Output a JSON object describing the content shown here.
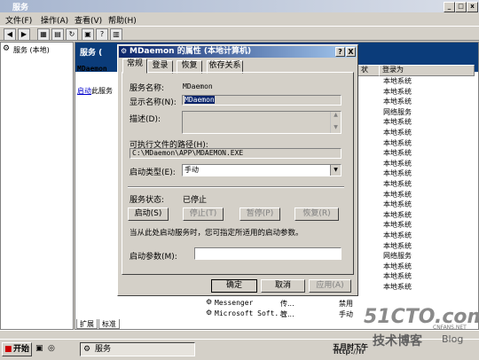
{
  "window": {
    "title": "服务"
  },
  "menu": [
    "文件(F)",
    "操作(A)",
    "查看(V)",
    "帮助(H)"
  ],
  "tree": {
    "root": "服务 (本地)"
  },
  "content": {
    "header": "服务 (",
    "left_name": "MDaemon",
    "start_link": "启动",
    "start_link_rest": "此服务",
    "col_status": "状",
    "col_logon": "登录为",
    "logon_rows": [
      "本地系统",
      "本地系统",
      "本地系统",
      "网络服务",
      "本地系统",
      "本地系统",
      "本地系统",
      "本地系统",
      "本地系统",
      "本地系统",
      "本地系统",
      "本地系统",
      "本地系统",
      "本地系统",
      "本地系统",
      "本地系统",
      "本地系统",
      "网络服务",
      "本地系统",
      "本地系统",
      "本地系统"
    ],
    "bottom_rows": [
      {
        "name": "Messenger",
        "status": "传...",
        "startup": "禁用"
      },
      {
        "name": "Microsoft Soft...",
        "status": "管...",
        "startup": "手动"
      }
    ],
    "tabs": [
      "扩展",
      "标准"
    ]
  },
  "dialog": {
    "title": "MDaemon 的属性 (本地计算机)",
    "help_btn": "?",
    "close_btn": "X",
    "tabs": [
      "常规",
      "登录",
      "恢复",
      "依存关系"
    ],
    "service_name_label": "服务名称:",
    "service_name": "MDaemon",
    "display_name_label": "显示名称(N):",
    "display_name": "MDaemon",
    "desc_label": "描述(D):",
    "path_label": "可执行文件的路径(H):",
    "path": "C:\\MDaemon\\APP\\MDAEMON.EXE",
    "startup_type_label": "启动类型(E):",
    "startup_type": "手动",
    "status_label": "服务状态:",
    "status": "已停止",
    "btn_start": "启动(S)",
    "btn_stop": "停止(T)",
    "btn_pause": "暂停(P)",
    "btn_resume": "恢复(R)",
    "hint": "当从此处启动服务时，您可指定所适用的启动参数。",
    "params_label": "启动参数(M):",
    "params": "",
    "btn_ok": "确定",
    "btn_cancel": "取消",
    "btn_apply": "应用(A)"
  },
  "taskbar": {
    "start": "开始",
    "task": "服务",
    "clock": "五月时下午"
  },
  "watermark": {
    "brand": "51CTO.com",
    "sub": "技术博客",
    "blog": "Blog",
    "url": "http://fr",
    "small": "CNFANS.NET"
  }
}
